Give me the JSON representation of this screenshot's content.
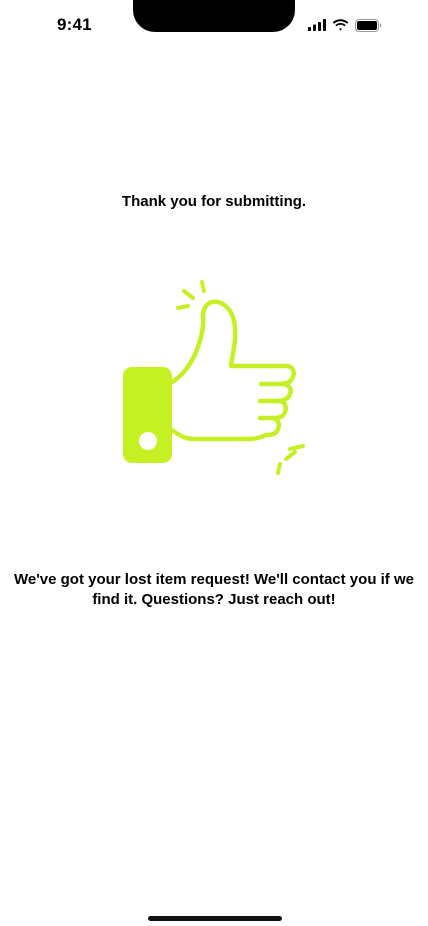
{
  "status_bar": {
    "time": "9:41",
    "icons": [
      "cellular-signal-icon",
      "wifi-icon",
      "battery-icon"
    ]
  },
  "confirmation": {
    "title": "Thank you for submitting.",
    "illustration": "thumbs-up-icon",
    "message": "We've got your lost item request! We'll contact you if we find it. Questions? Just reach out!"
  },
  "colors": {
    "accent": "#C5F124",
    "text": "#000000",
    "background": "#FFFFFF"
  }
}
